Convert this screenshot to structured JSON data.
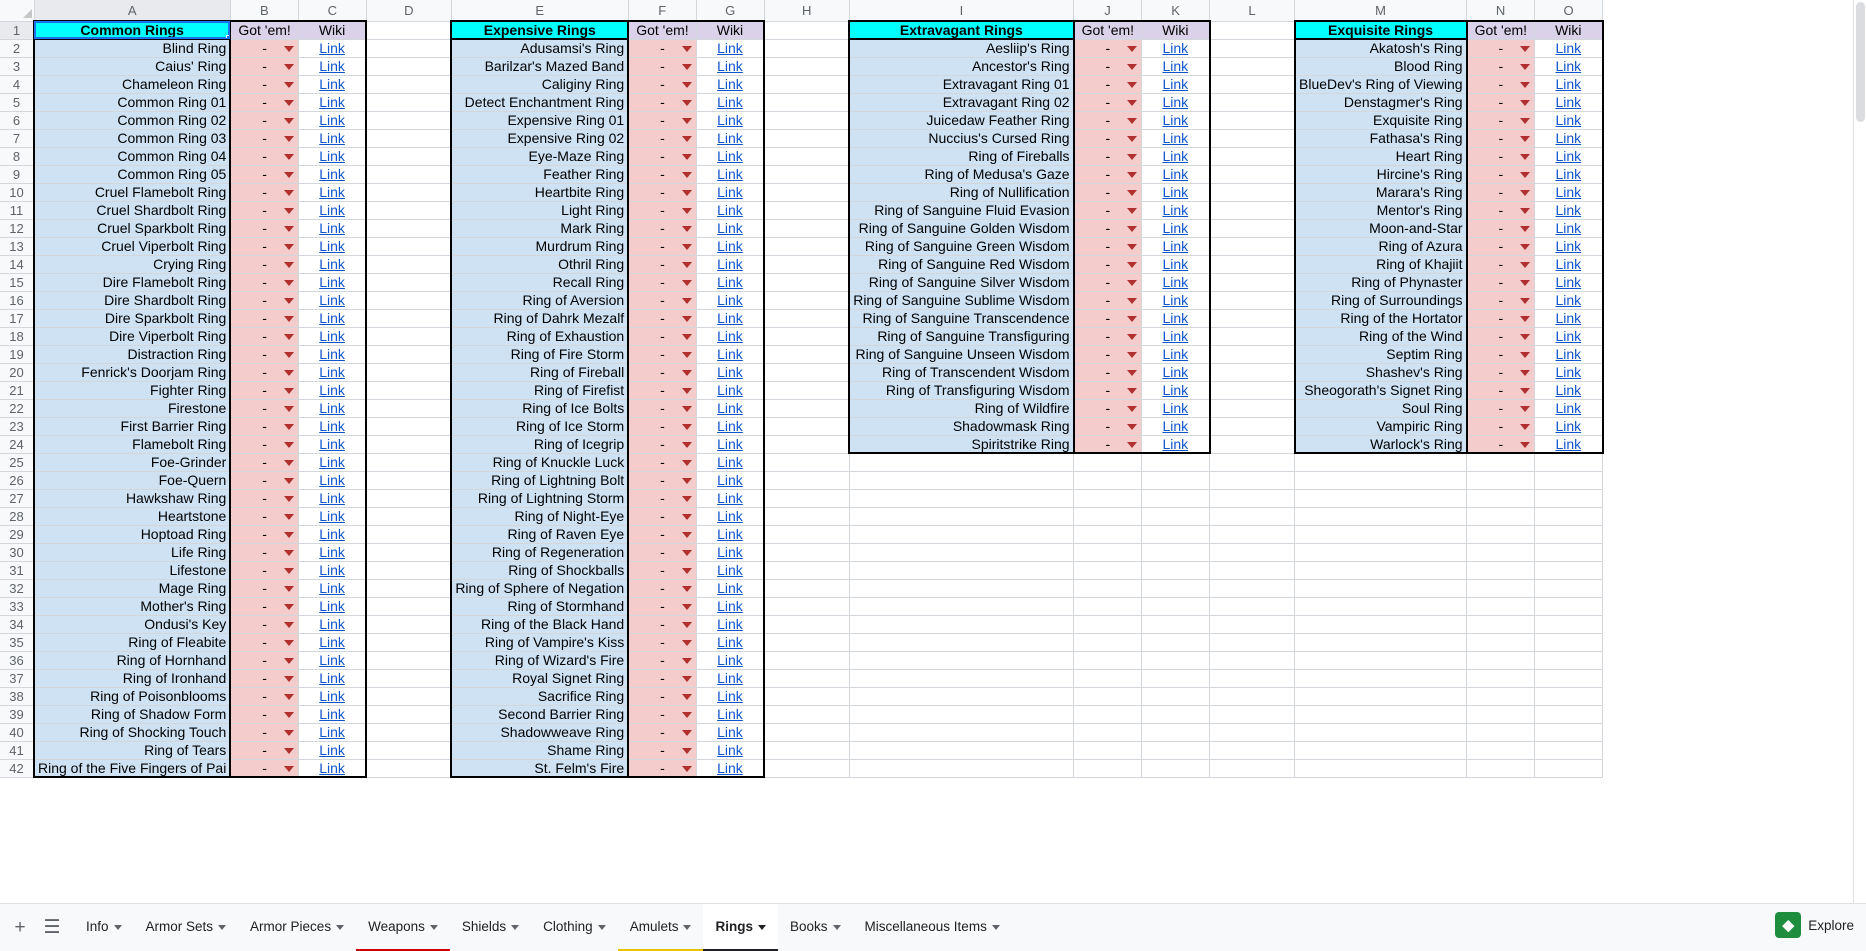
{
  "app": {
    "scrollbar": {
      "left_arrow": "◀",
      "right_arrow": "▶"
    }
  },
  "grid": {
    "columns": [
      "A",
      "B",
      "C",
      "D",
      "E",
      "F",
      "G",
      "H",
      "I",
      "J",
      "K",
      "L",
      "M",
      "N",
      "O"
    ],
    "row_numbers": [
      1,
      2,
      3,
      4,
      5,
      6,
      7,
      8,
      9,
      10,
      11,
      12,
      13,
      14,
      15,
      16,
      17,
      18,
      19,
      20,
      21,
      22,
      23,
      24,
      25,
      26,
      27,
      28,
      29,
      30,
      31,
      32,
      33,
      34,
      35,
      36,
      37,
      38,
      39,
      40,
      41,
      42
    ],
    "headers": {
      "common": "Common Rings",
      "expensive": "Expensive Rings",
      "extravagant": "Extravagant Rings",
      "exquisite": "Exquisite Rings",
      "got_em": "Got 'em!",
      "wiki": "Wiki"
    },
    "link_label": "Link",
    "got_value": "-",
    "common_rings": [
      "Blind Ring",
      "Caius' Ring",
      "Chameleon Ring",
      "Common Ring 01",
      "Common Ring 02",
      "Common Ring 03",
      "Common Ring 04",
      "Common Ring 05",
      "Cruel Flamebolt Ring",
      "Cruel Shardbolt Ring",
      "Cruel Sparkbolt Ring",
      "Cruel Viperbolt Ring",
      "Crying Ring",
      "Dire Flamebolt Ring",
      "Dire Shardbolt Ring",
      "Dire Sparkbolt Ring",
      "Dire Viperbolt Ring",
      "Distraction Ring",
      "Fenrick's Doorjam Ring",
      "Fighter Ring",
      "Firestone",
      "First Barrier Ring",
      "Flamebolt Ring",
      "Foe-Grinder",
      "Foe-Quern",
      "Hawkshaw Ring",
      "Heartstone",
      "Hoptoad Ring",
      "Life Ring",
      "Lifestone",
      "Mage Ring",
      "Mother's Ring",
      "Ondusi's Key",
      "Ring of Fleabite",
      "Ring of Hornhand",
      "Ring of Ironhand",
      "Ring of Poisonblooms",
      "Ring of Shadow Form",
      "Ring of Shocking Touch",
      "Ring of Tears",
      "Ring of the Five Fingers of Pai"
    ],
    "expensive_rings": [
      "Adusamsi's Ring",
      "Barilzar's Mazed Band",
      "Caliginy Ring",
      "Detect Enchantment Ring",
      "Expensive Ring 01",
      "Expensive Ring 02",
      "Eye-Maze Ring",
      "Feather Ring",
      "Heartbite Ring",
      "Light Ring",
      "Mark Ring",
      "Murdrum Ring",
      "Othril Ring",
      "Recall Ring",
      "Ring of Aversion",
      "Ring of Dahrk Mezalf",
      "Ring of Exhaustion",
      "Ring of Fire Storm",
      "Ring of Fireball",
      "Ring of Firefist",
      "Ring of Ice Bolts",
      "Ring of Ice Storm",
      "Ring of Icegrip",
      "Ring of Knuckle Luck",
      "Ring of Lightning Bolt",
      "Ring of Lightning Storm",
      "Ring of Night-Eye",
      "Ring of Raven Eye",
      "Ring of Regeneration",
      "Ring of Shockballs",
      "Ring of Sphere of Negation",
      "Ring of Stormhand",
      "Ring of the Black Hand",
      "Ring of Vampire's Kiss",
      "Ring of Wizard's Fire",
      "Royal Signet Ring",
      "Sacrifice Ring",
      "Second Barrier Ring",
      "Shadowweave Ring",
      "Shame Ring",
      "St. Felm's Fire"
    ],
    "extravagant_rings": [
      "Aesliip's Ring",
      "Ancestor's Ring",
      "Extravagant Ring 01",
      "Extravagant Ring 02",
      "Juicedaw Feather Ring",
      "Nuccius's Cursed Ring",
      "Ring of Fireballs",
      "Ring of Medusa's Gaze",
      "Ring of Nullification",
      "Ring of Sanguine Fluid Evasion",
      "Ring of Sanguine Golden Wisdom",
      "Ring of Sanguine Green Wisdom",
      "Ring of Sanguine Red Wisdom",
      "Ring of Sanguine Silver Wisdom",
      "Ring of Sanguine Sublime Wisdom",
      "Ring of Sanguine Transcendence",
      "Ring of Sanguine Transfiguring",
      "Ring of Sanguine Unseen Wisdom",
      "Ring of Transcendent Wisdom",
      "Ring of Transfiguring Wisdom",
      "Ring of Wildfire",
      "Shadowmask Ring",
      "Spiritstrike Ring"
    ],
    "exquisite_rings": [
      "Akatosh's Ring",
      "Blood Ring",
      "BlueDev's Ring of Viewing",
      "Denstagmer's Ring",
      "Exquisite Ring",
      "Fathasa's Ring",
      "Heart Ring",
      "Hircine's Ring",
      "Marara's Ring",
      "Mentor's Ring",
      "Moon-and-Star",
      "Ring of Azura",
      "Ring of Khajiit",
      "Ring of Phynaster",
      "Ring of Surroundings",
      "Ring of the Hortator",
      "Ring of the Wind",
      "Septim Ring",
      "Shashev's Ring",
      "Sheogorath's Signet Ring",
      "Soul Ring",
      "Vampiric Ring",
      "Warlock's Ring"
    ]
  },
  "tabbar": {
    "add_label": "+",
    "all_sheets_label": "☰",
    "tabs": [
      {
        "label": "Info",
        "active": false,
        "underline": ""
      },
      {
        "label": "Armor Sets",
        "active": false,
        "underline": ""
      },
      {
        "label": "Armor Pieces",
        "active": false,
        "underline": ""
      },
      {
        "label": "Weapons",
        "active": false,
        "underline": "u-red"
      },
      {
        "label": "Shields",
        "active": false,
        "underline": ""
      },
      {
        "label": "Clothing",
        "active": false,
        "underline": ""
      },
      {
        "label": "Amulets",
        "active": false,
        "underline": "u-yellow"
      },
      {
        "label": "Rings",
        "active": true,
        "underline": "u-dark"
      },
      {
        "label": "Books",
        "active": false,
        "underline": ""
      },
      {
        "label": "Miscellaneous Items",
        "active": false,
        "underline": ""
      }
    ],
    "explore_label": "Explore",
    "explore_icon": "◆"
  },
  "colors": {
    "title_bg": "#00ffff",
    "header_bg": "#d9d2e9",
    "name_bg": "#cfe2f3",
    "got_bg": "#f4cccc",
    "link": "#1155cc",
    "accent": "#1a73e8"
  }
}
